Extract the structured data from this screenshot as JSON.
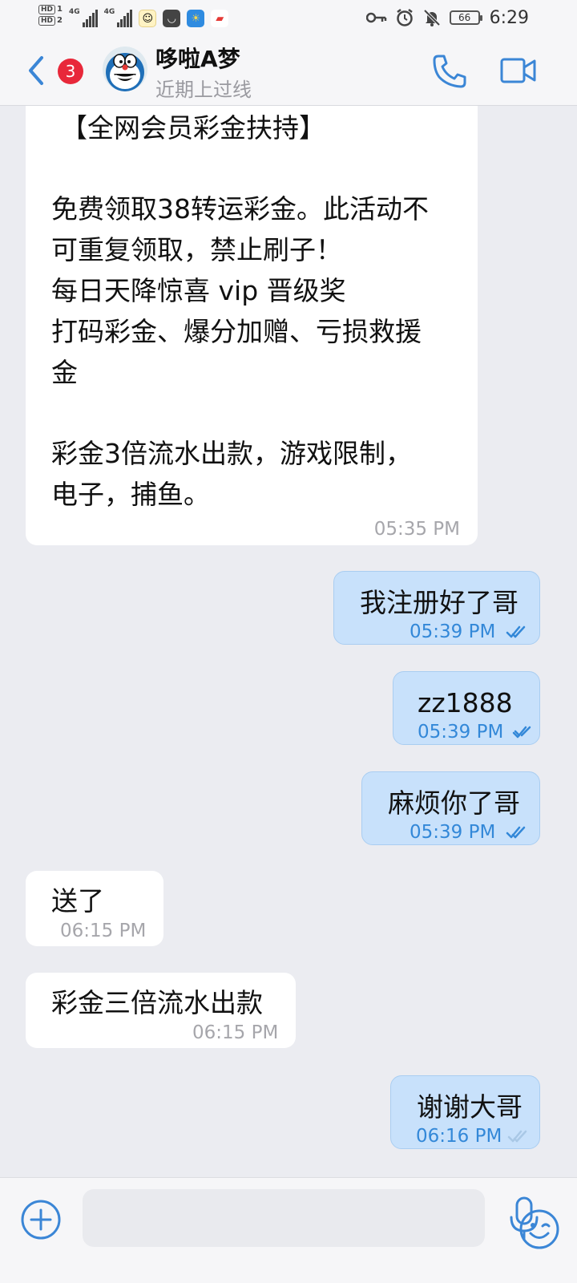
{
  "status_bar": {
    "hd1": "HD",
    "hd1_num": "1",
    "hd2": "HD",
    "hd2_num": "2",
    "net1": "4G",
    "net2": "4G",
    "battery": "66",
    "time": "6:29",
    "icons": [
      "key-icon",
      "alarm-icon",
      "mute-icon",
      "battery-icon"
    ]
  },
  "header": {
    "unread_badge": "3",
    "contact_name": "哆啦A梦",
    "contact_status": "近期上过线"
  },
  "messages": [
    {
      "direction": "in",
      "text": "【全网会员彩金扶持】\n\n免费领取38转运彩金。此活动不可重复领取，禁止刷子！\n每日天降惊喜 vip 晋级奖\n打码彩金、爆分加赠、亏损救援金\n\n彩金3倍流水出款，游戏限制，电子，捕鱼。",
      "lines": [
        "【全网会员彩金扶持】",
        "",
        "免费领取38转运彩金。此活动不",
        "可重复领取，禁止刷子！",
        "每日天降惊喜 vip 晋级奖",
        "打码彩金、爆分加赠、亏损救援",
        "金",
        "",
        "彩金3倍流水出款，游戏限制，",
        "电子，捕鱼。"
      ],
      "time": "05:35 PM"
    },
    {
      "direction": "out",
      "text": "我注册好了哥",
      "time": "05:39 PM",
      "status": "read"
    },
    {
      "direction": "out",
      "text": "zz1888",
      "time": "05:39 PM",
      "status": "delivered"
    },
    {
      "direction": "out",
      "text": "麻烦你了哥",
      "time": "05:39 PM",
      "status": "read"
    },
    {
      "direction": "in",
      "text": "送了",
      "time": "06:15 PM"
    },
    {
      "direction": "in",
      "text": "彩金三倍流水出款",
      "time": "06:15 PM"
    },
    {
      "direction": "out",
      "text": "谢谢大哥",
      "time": "06:16 PM",
      "status": "sent"
    }
  ],
  "input_bar": {
    "placeholder": ""
  },
  "colors": {
    "accent": "#3b86d6",
    "badge": "#e8283a",
    "outgoing_bubble": "#c8e1fb",
    "incoming_bubble": "#ffffff",
    "background": "#ebecf1"
  }
}
